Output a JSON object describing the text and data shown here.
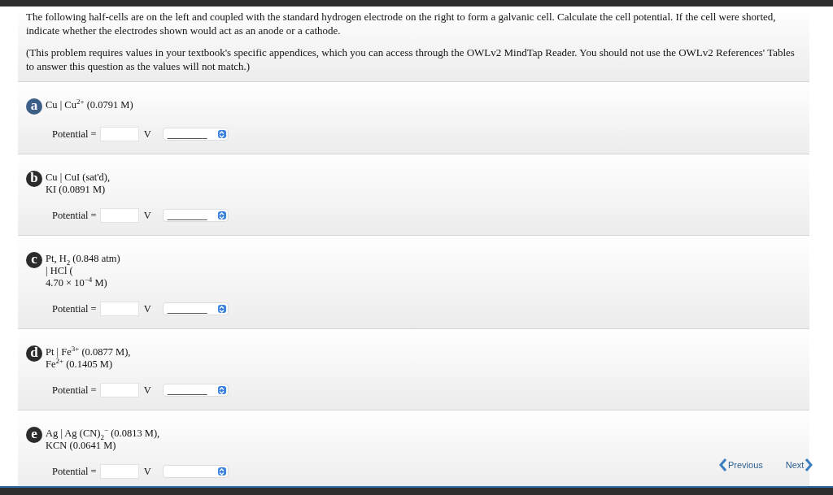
{
  "intro": [
    "The following half-cells are on the left and coupled with the standard hydrogen electrode on the right to form a galvanic cell. Calculate the cell potential. If the cell were shorted, indicate whether the electrodes shown would act as an anode or a cathode.",
    "(This problem requires values in your textbook's specific appendices, which you can access through the OWLv2 MindTap Reader. You should not use the OWLv2 References' Tables to answer this question as the values will not match.)"
  ],
  "parts": [
    {
      "letter": "a",
      "color": "#3d5f87",
      "lines": [
        "Cu | Cu$^{2+}$ (0.0791 M)"
      ],
      "label": "Potential =",
      "unit": "V",
      "select": "________"
    },
    {
      "letter": "b",
      "color": "#2b2b2b",
      "lines": [
        "Cu | CuI (sat'd),",
        "KI (0.0891 M)"
      ],
      "label": "Potential =",
      "unit": "V",
      "select": "________"
    },
    {
      "letter": "c",
      "color": "#2b2b2b",
      "lines": [
        "Pt, H$_{2}$ (0.848 atm)",
        "| HCl (",
        "4.70 × 10$^{−4}$ M)"
      ],
      "label": "Potential =",
      "unit": "V",
      "select": "________"
    },
    {
      "letter": "d",
      "color": "#2b2b2b",
      "lines": [
        "Pt | Fe$^{3+}$ (0.0877 M),",
        "Fe$^{2+}$ (0.1405 M)"
      ],
      "label": "Potential =",
      "unit": "V",
      "select": "________"
    },
    {
      "letter": "e",
      "color": "#2b2b2b",
      "lines": [
        "Ag | Ag (CN)$_{2}$$^{−}$ (0.0813 M),",
        "KCN (0.0641 M)"
      ],
      "label": "Potential =",
      "unit": "V"
    }
  ],
  "nav": {
    "previous": "Previous",
    "next": "Next"
  }
}
